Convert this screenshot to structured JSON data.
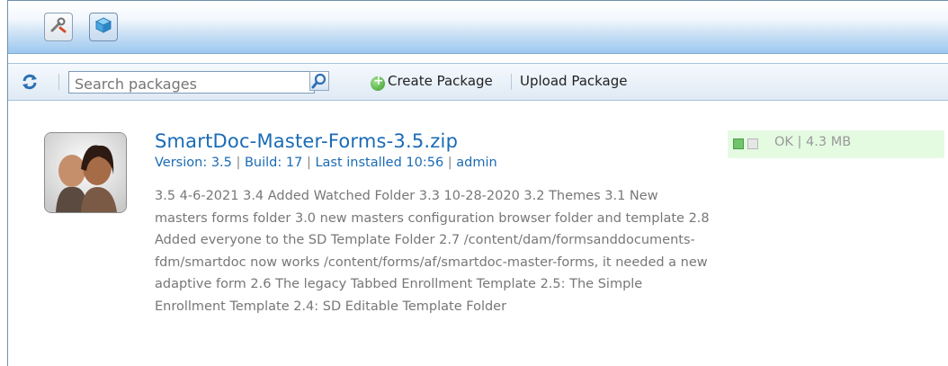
{
  "toolbar": {
    "search": {
      "placeholder": "Search packages"
    },
    "create_label": "Create Package",
    "upload_label": "Upload Package"
  },
  "package": {
    "title": "SmartDoc-Master-Forms-3.5.zip",
    "version": "Version: 3.5",
    "build": "Build: 17",
    "last_installed": "Last installed 10:56",
    "user": "admin",
    "description": "3.5 4-6-2021 3.4 Added Watched Folder 3.3 10-28-2020 3.2 Themes 3.1 New masters forms folder 3.0 new masters configuration browser folder and template 2.8 Added everyone to the SD Template Folder 2.7 /content/dam/formsanddocuments-fdm/smartdoc now works /content/forms/af/smartdoc-master-forms, it needed a new adaptive form 2.6 The legacy Tabbed Enrollment Template 2.5: The Simple Enrollment Template 2.4: SD Editable Template Folder",
    "status": "OK",
    "size": "4.3 MB"
  },
  "colors": {
    "link": "#1a6bb5",
    "status_bg": "#e4fbe2",
    "topbar_blue": "#9cc8ef"
  }
}
